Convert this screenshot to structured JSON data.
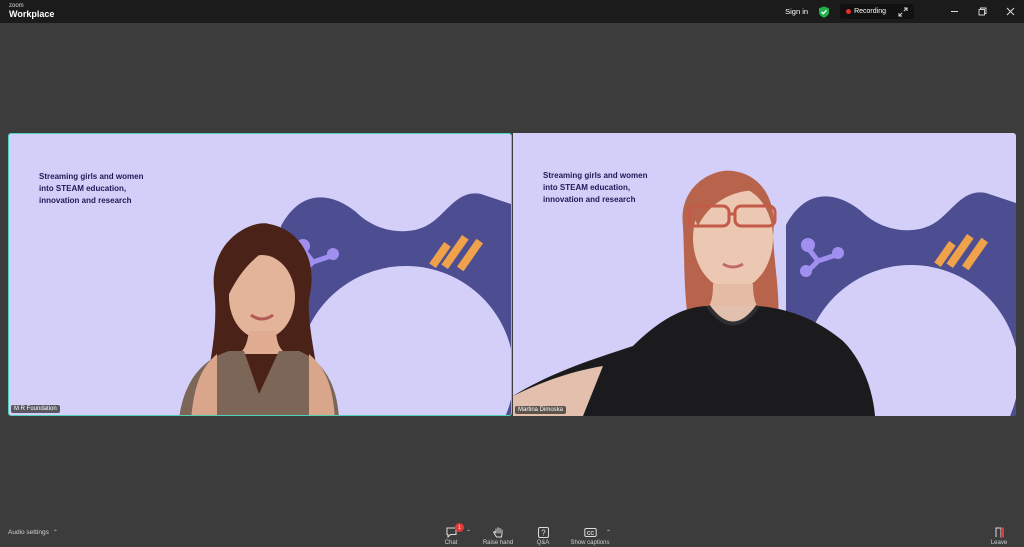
{
  "app": {
    "brand_small": "zoom",
    "brand_large": "Workplace"
  },
  "titlebar": {
    "signin": "Sign in",
    "recording": "Recording"
  },
  "tiles": [
    {
      "tagline": "Streaming girls and women into STEAM education, innovation and research",
      "name": "M R Foundation"
    },
    {
      "tagline": "Streaming girls and women into STEAM education, innovation and research",
      "name": "Martina Dimoska"
    }
  ],
  "colors": {
    "tile_bg": "#d4cff8",
    "shape": "#4d4e92",
    "accent_orange": "#f0a24a",
    "active_border": "#4fd2b6",
    "record": "#e5322d"
  },
  "toolbar": {
    "audio_settings": "Audio settings",
    "chat_label": "Chat",
    "chat_badge": "1",
    "raise_hand_label": "Raise hand",
    "qa_label": "Q&A",
    "captions_label": "Show captions",
    "leave_label": "Leave"
  }
}
